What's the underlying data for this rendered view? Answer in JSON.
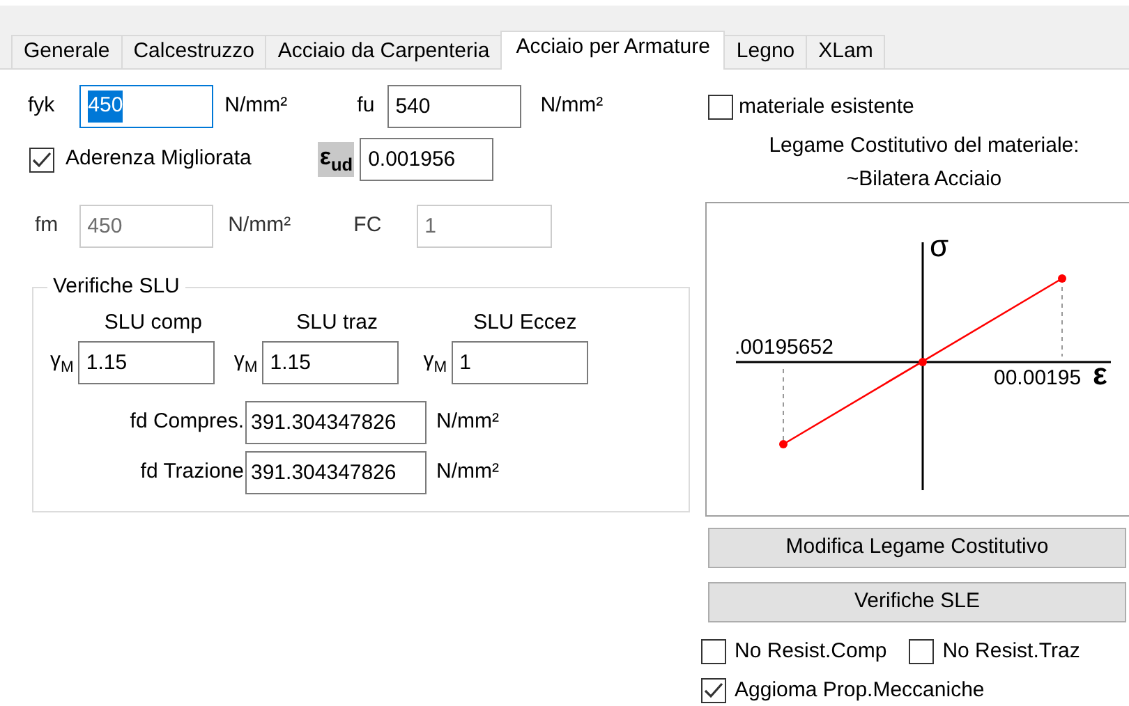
{
  "tabs": [
    {
      "label": "Generale",
      "selected": false
    },
    {
      "label": "Calcestruzzo",
      "selected": false
    },
    {
      "label": "Acciaio da Carpenteria",
      "selected": false
    },
    {
      "label": "Acciaio per Armature",
      "selected": true
    },
    {
      "label": "Legno",
      "selected": false
    },
    {
      "label": "XLam",
      "selected": false
    }
  ],
  "fyk": {
    "label": "fyk",
    "value": "450",
    "unit": "N/mm²",
    "focused": true
  },
  "fu": {
    "label": "fu",
    "value": "540",
    "unit": "N/mm²"
  },
  "aderenza": {
    "label": "Aderenza Migliorata",
    "checked": true
  },
  "eps_ud": {
    "symbol": "ε",
    "subscript": "ud",
    "value": "0.001956"
  },
  "fm": {
    "label": "fm",
    "value": "450",
    "unit": "N/mm²",
    "disabled": true
  },
  "fc": {
    "label": "FC",
    "value": "1",
    "disabled": true
  },
  "slu": {
    "legend": "Verifiche SLU",
    "columns": [
      {
        "heading": "SLU comp",
        "symbol": "γ",
        "subscript": "M",
        "value": "1.15"
      },
      {
        "heading": "SLU traz",
        "symbol": "γ",
        "subscript": "M",
        "value": "1.15"
      },
      {
        "heading": "SLU Eccez",
        "symbol": "γ",
        "subscript": "M",
        "value": "1"
      }
    ],
    "results": [
      {
        "label": "fd Compres.",
        "value": "391.304347826",
        "unit": "N/mm²"
      },
      {
        "label": "fd Trazione",
        "value": "391.304347826",
        "unit": "N/mm²"
      }
    ]
  },
  "materiale_esistente": {
    "label": "materiale esistente",
    "checked": false
  },
  "legame": {
    "title": "Legame Costitutivo del materiale:",
    "name": "~Bilatera Acciaio"
  },
  "diagram": {
    "y_axis_label": "σ",
    "x_axis_label": "ε",
    "left_label": ".00195652",
    "right_label": "00.00195"
  },
  "buttons": [
    "Modifica Legame Costitutivo",
    "Verifiche SLE"
  ],
  "options": [
    {
      "label": "No Resist.Comp",
      "checked": false
    },
    {
      "label": "No Resist.Traz",
      "checked": false
    },
    {
      "label": "Aggioma Prop.Meccaniche",
      "checked": true
    }
  ]
}
